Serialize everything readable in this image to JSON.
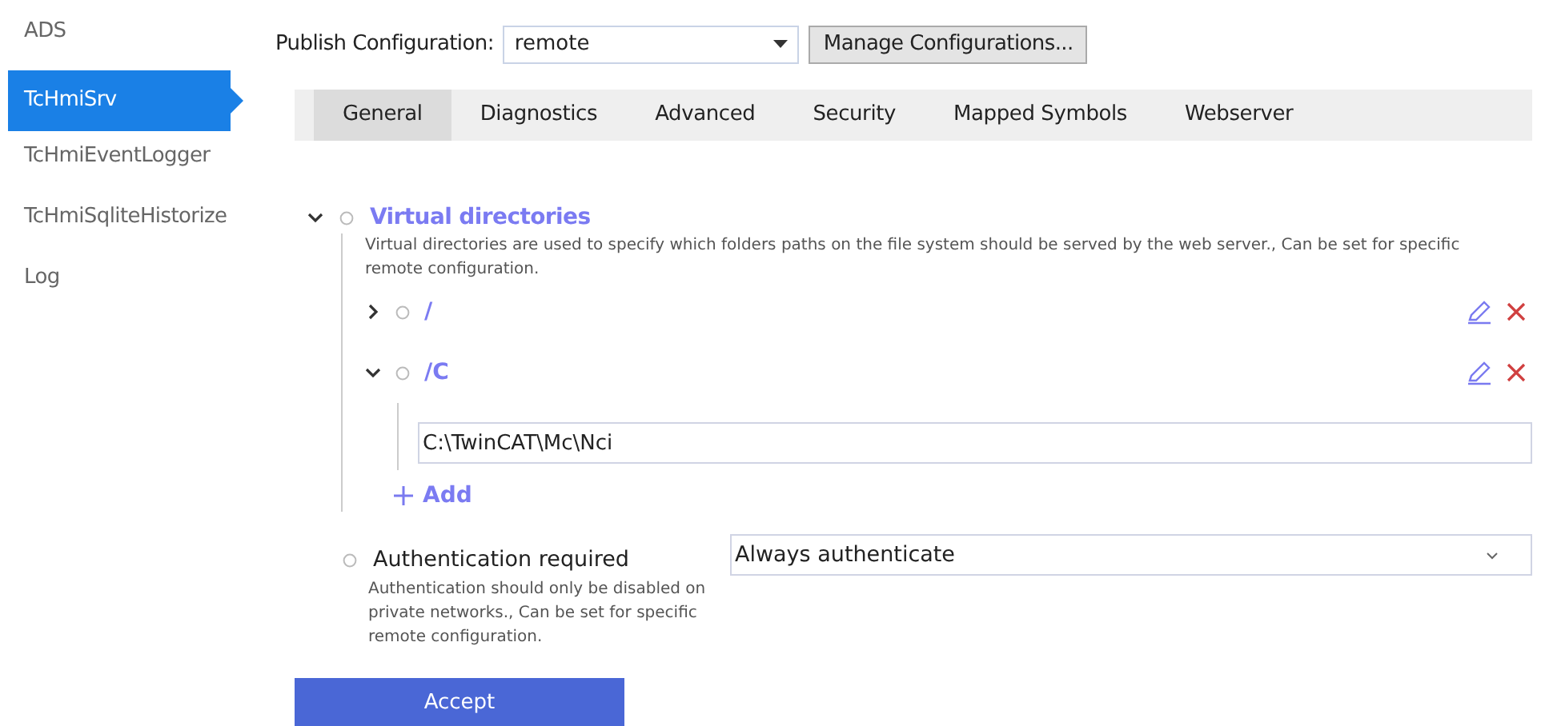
{
  "sidebar": {
    "items": [
      {
        "label": "ADS",
        "selected": false
      },
      {
        "label": "TcHmiSrv",
        "selected": true
      },
      {
        "label": "TcHmiEventLogger",
        "selected": false
      },
      {
        "label": "TcHmiSqliteHistorize",
        "selected": false
      },
      {
        "label": "Log",
        "selected": false
      }
    ]
  },
  "publish": {
    "label": "Publish Configuration:",
    "value": "remote",
    "manage_button": "Manage Configurations..."
  },
  "tabs": [
    {
      "label": "General",
      "selected": true
    },
    {
      "label": "Diagnostics",
      "selected": false
    },
    {
      "label": "Advanced",
      "selected": false
    },
    {
      "label": "Security",
      "selected": false
    },
    {
      "label": "Mapped Symbols",
      "selected": false
    },
    {
      "label": "Webserver",
      "selected": false
    }
  ],
  "settings": [
    {
      "kind": "group",
      "title": "Virtual directories",
      "expanded": true,
      "description": "Virtual directories are used to specify which folders paths on the file system should be served by the web server., Can be set for specific remote configuration.",
      "entries": [
        {
          "name": "/",
          "expanded": false
        },
        {
          "name": "/C",
          "expanded": true,
          "value": "C:\\TwinCAT\\Mc\\Nci"
        }
      ],
      "add_label": "Add"
    },
    {
      "kind": "select",
      "title": "Authentication required",
      "description": "Authentication should only be disabled on private networks., Can be set for specific remote configuration.",
      "value": "Always authenticate"
    }
  ],
  "accept_button": "Accept"
}
